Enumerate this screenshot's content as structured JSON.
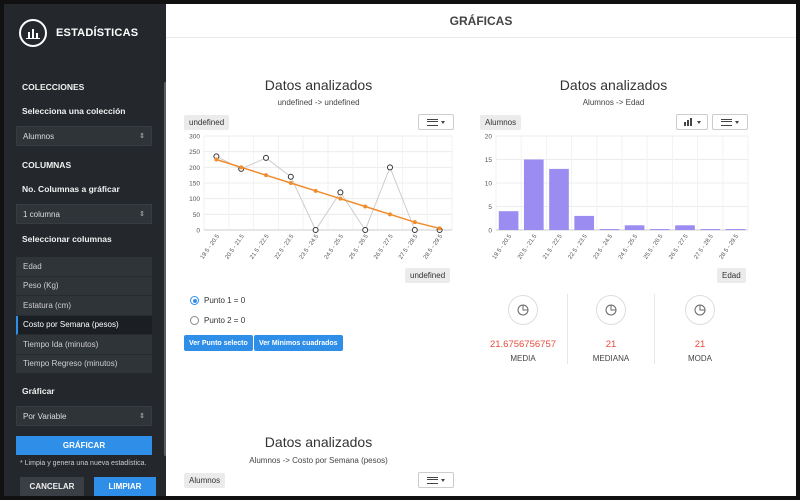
{
  "sidebar": {
    "title": "ESTADÍSTICAS",
    "collections_heading": "COLECCIONES",
    "collection_label": "Selecciona una colección",
    "collection_value": "Alumnos",
    "columns_heading": "COLUMNAS",
    "ncols_label": "No. Columnas a gráficar",
    "ncols_value": "1 columna",
    "select_cols_label": "Seleccionar columnas",
    "columns": [
      "Edad",
      "Peso (Kg)",
      "Estatura (cm)",
      "Costo por Semana (pesos)",
      "Tiempo Ida (minutos)",
      "Tiempo Regreso (minutos)"
    ],
    "graficar_label": "Gráficar",
    "graficar_value": "Por Variable",
    "graficar_button": "GRÁFICAR",
    "note": "* Limpia y genera una nueva estadística.",
    "cancel_button": "CANCELAR",
    "clean_button": "LIMPIAR",
    "accent": "#2f8fe8"
  },
  "main": {
    "title": "GRÁFICAS",
    "chart1": {
      "title": "Datos analizados",
      "subtitle": "undefined -> undefined",
      "ytag": "undefined",
      "xtag": "undefined"
    },
    "chart2": {
      "title": "Datos analizados",
      "subtitle": "Alumnos -> Edad",
      "ytag": "Alumnos",
      "xtag": "Edad"
    },
    "chart3": {
      "title": "Datos analizados",
      "subtitle": "Alumnos -> Costo por Semana (pesos)",
      "ytag": "Alumnos"
    },
    "radios": [
      "Punto 1 = 0",
      "Punto 2 = 0"
    ],
    "buttons": [
      "Ver Punto selecto",
      "Ver Minimos cuadrados"
    ],
    "stats": [
      {
        "value": "21.6756756757",
        "label": "MEDIA",
        "icon": "pie-chart-icon"
      },
      {
        "value": "21",
        "label": "MEDIANA",
        "icon": "pie-chart-icon"
      },
      {
        "value": "21",
        "label": "MODA",
        "icon": "pie-chart-icon"
      }
    ],
    "stat_color": "#e74c3c"
  },
  "chart_data": [
    {
      "type": "line",
      "categories": [
        "19.5 - 20.5",
        "20.5 - 21.5",
        "21.5 - 22.5",
        "22.5 - 23.5",
        "23.5 - 24.5",
        "24.5 - 25.5",
        "25.5 - 26.5",
        "26.5 - 27.5",
        "27.5 - 28.5",
        "28.5 - 29.5"
      ],
      "yticks": [
        0,
        50,
        100,
        150,
        200,
        250,
        300
      ],
      "ylim": [
        0,
        300
      ],
      "series": [
        {
          "values": [
            235,
            195,
            230,
            170,
            0,
            120,
            0,
            200,
            0,
            0
          ],
          "color": "#cccccc"
        },
        {
          "values": [
            225,
            200,
            175,
            150,
            125,
            100,
            75,
            50,
            25,
            5
          ],
          "color": "#f08c2c"
        }
      ]
    },
    {
      "type": "bar",
      "categories": [
        "19.5 - 20.5",
        "20.5 - 21.5",
        "21.5 - 22.5",
        "22.5 - 23.5",
        "23.5 - 24.5",
        "24.5 - 25.5",
        "25.5 - 26.5",
        "26.5 - 27.5",
        "27.5 - 28.5",
        "28.5 - 29.5"
      ],
      "values": [
        4,
        15,
        13,
        3,
        0.2,
        1,
        0.2,
        1,
        0.2,
        0.2
      ],
      "yticks": [
        0,
        5,
        10,
        15,
        20
      ],
      "ylim": [
        0,
        20
      ],
      "color": "#9b8cf2"
    }
  ]
}
